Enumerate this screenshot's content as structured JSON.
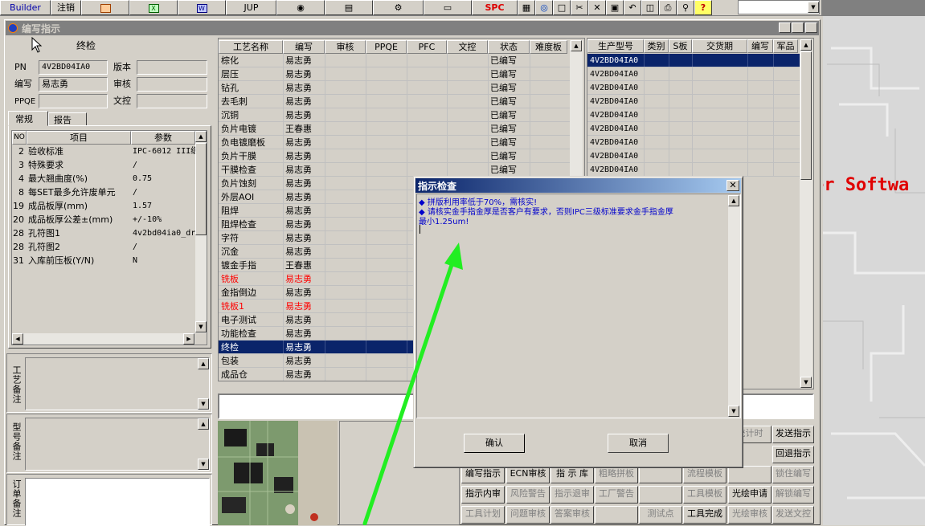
{
  "toolbar": {
    "builder": "Builder",
    "logout": "注销",
    "jup": "JUP",
    "spc": "SPC"
  },
  "window": {
    "title": "编写指示"
  },
  "left_panel": {
    "heading": "终检",
    "pn_label": "PN",
    "pn_value": "4V2BD04IA0",
    "version_label": "版本",
    "version_value": "",
    "author_label": "编写",
    "author_value": "易志勇",
    "review_label": "审核",
    "review_value": "",
    "ppqe_label": "PPQE",
    "ppqe_value": "",
    "doc_label": "文控",
    "doc_value": "",
    "tabs": [
      "常规",
      "报告"
    ],
    "params_headers": [
      "NO",
      "项目",
      "参数"
    ],
    "params": [
      {
        "no": "2",
        "item": "验收标准",
        "value": "IPC-6012 III级"
      },
      {
        "no": "3",
        "item": "特殊要求",
        "value": "/"
      },
      {
        "no": "4",
        "item": "最大翘曲度(%)",
        "value": "0.75"
      },
      {
        "no": "8",
        "item": "每SET最多允许废单元",
        "value": "/"
      },
      {
        "no": "19",
        "item": "成品板厚(mm)",
        "value": "1.57"
      },
      {
        "no": "20",
        "item": "成品板厚公差±(mm)",
        "value": "+/-10%"
      },
      {
        "no": "28",
        "item": "孔符图1",
        "value": "4v2bd04ia0_dr"
      },
      {
        "no": "28",
        "item": "孔符图2",
        "value": "/"
      },
      {
        "no": "31",
        "item": "入库前压板(Y/N)",
        "value": "N"
      }
    ],
    "notes": [
      "工艺备注",
      "型号备注",
      "订单备注"
    ]
  },
  "process_table": {
    "headers": [
      "工艺名称",
      "编写",
      "审核",
      "PPQE",
      "PFC",
      "文控",
      "状态",
      "难度板"
    ],
    "rows": [
      {
        "name": "棕化",
        "author": "易志勇",
        "status": "已编写",
        "red": false
      },
      {
        "name": "层压",
        "author": "易志勇",
        "status": "已编写",
        "red": false
      },
      {
        "name": "钻孔",
        "author": "易志勇",
        "status": "已编写",
        "red": false
      },
      {
        "name": "去毛刺",
        "author": "易志勇",
        "status": "已编写",
        "red": false
      },
      {
        "name": "沉铜",
        "author": "易志勇",
        "status": "已编写",
        "red": false
      },
      {
        "name": "负片电镀",
        "author": "王春惠",
        "status": "已编写",
        "red": false
      },
      {
        "name": "负电镀磨板",
        "author": "易志勇",
        "status": "已编写",
        "red": false
      },
      {
        "name": "负片干膜",
        "author": "易志勇",
        "status": "已编写",
        "red": false
      },
      {
        "name": "干膜检查",
        "author": "易志勇",
        "status": "已编写",
        "red": false
      },
      {
        "name": "负片蚀刻",
        "author": "易志勇",
        "status": "",
        "red": false
      },
      {
        "name": "外层AOI",
        "author": "易志勇",
        "status": "",
        "red": false
      },
      {
        "name": "阻焊",
        "author": "易志勇",
        "status": "",
        "red": false
      },
      {
        "name": "阻焊检查",
        "author": "易志勇",
        "status": "",
        "red": false
      },
      {
        "name": "字符",
        "author": "易志勇",
        "status": "",
        "red": false
      },
      {
        "name": "沉金",
        "author": "易志勇",
        "status": "",
        "red": false
      },
      {
        "name": "镀金手指",
        "author": "王春惠",
        "status": "",
        "red": false
      },
      {
        "name": "铣板",
        "author": "易志勇",
        "status": "",
        "red": true
      },
      {
        "name": "金指倒边",
        "author": "易志勇",
        "status": "",
        "red": false
      },
      {
        "name": "铣板1",
        "author": "易志勇",
        "status": "",
        "red": true
      },
      {
        "name": "电子测试",
        "author": "易志勇",
        "status": "",
        "red": false
      },
      {
        "name": "功能检查",
        "author": "易志勇",
        "status": "",
        "red": false
      },
      {
        "name": "终检",
        "author": "易志勇",
        "status": "",
        "red": false,
        "selected": true
      },
      {
        "name": "包装",
        "author": "易志勇",
        "status": "",
        "red": false
      },
      {
        "name": "成品仓",
        "author": "易志勇",
        "status": "",
        "red": false
      }
    ]
  },
  "product_table": {
    "headers": [
      "生产型号",
      "类别",
      "S板",
      "交货期",
      "编写",
      "军品"
    ],
    "rows": [
      "4V2BD04IA0",
      "4V2BD04IA0",
      "4V2BD04IA0",
      "4V2BD04IA0",
      "4V2BD04IA0",
      "4V2BD04IA0",
      "4V2BD04IA0",
      "4V2BD04IA0",
      "4V2BD04IA0"
    ]
  },
  "dialog": {
    "title": "指示检查",
    "line1": "◆ 拼版利用率低于70%，需核实!",
    "line2": "◆ 请核实金手指金厚是否客户有要求，否则IPC三级标准要求金手指金厚",
    "line3": "最小1.25um!",
    "ok": "确认",
    "cancel": "取消"
  },
  "action_buttons": [
    [
      "",
      "",
      "",
      "",
      "",
      "统计时",
      "发送指示"
    ],
    [
      "",
      "",
      "",
      "",
      "",
      "",
      "回退指示"
    ],
    [
      "编写指示",
      "ECN审核",
      "指 示 库",
      "粗略拼板",
      "",
      "流程模板",
      "锁住编写"
    ],
    [
      "指示内审",
      "风险警告",
      "指示退审",
      "工厂警告",
      "",
      "工具模板",
      "光绘申请",
      "解锁编写"
    ],
    [
      "工具计划",
      "问题审核",
      "答案审核",
      "",
      "测试点",
      "工具完成",
      "光绘审核",
      "发送文控"
    ]
  ],
  "background_text": "er Softwa",
  "colors": {
    "selected": "#0a246a",
    "red_text": "#ff0000",
    "dialog_text": "#0000cc",
    "arrow": "#22ee22"
  }
}
